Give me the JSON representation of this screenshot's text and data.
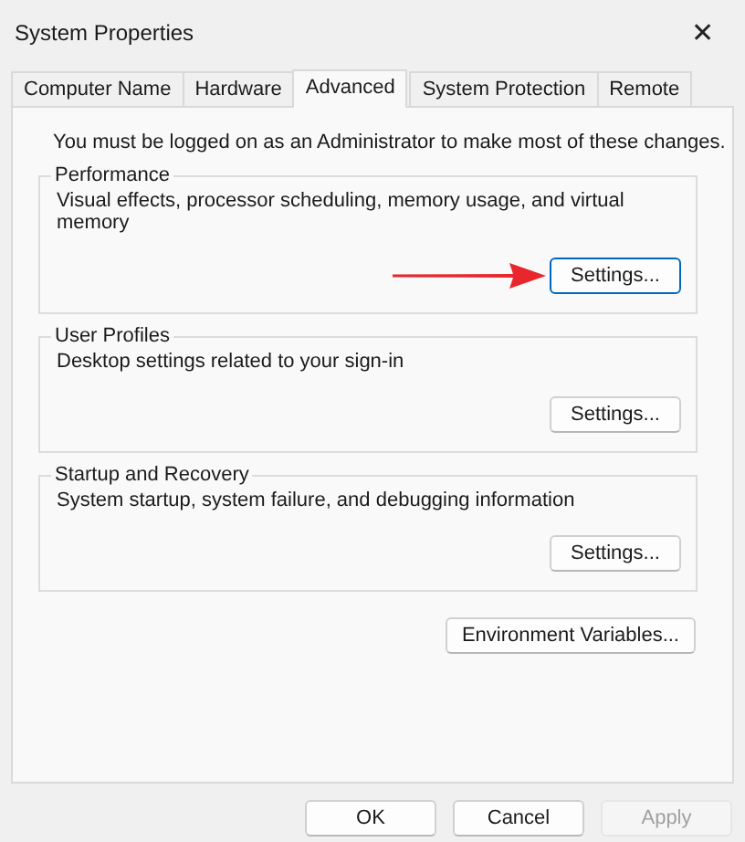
{
  "window": {
    "title": "System Properties",
    "close": "✕"
  },
  "tabs": [
    {
      "label": "Computer Name",
      "selected": false
    },
    {
      "label": "Hardware",
      "selected": false
    },
    {
      "label": "Advanced",
      "selected": true
    },
    {
      "label": "System Protection",
      "selected": false
    },
    {
      "label": "Remote",
      "selected": false
    }
  ],
  "notice": "You must be logged on as an Administrator to make most of these changes.",
  "groups": [
    {
      "title": "Performance",
      "description": "Visual effects, processor scheduling, memory usage, and virtual memory",
      "button": {
        "label": "Settings...",
        "focused": true,
        "pointed_at": true
      }
    },
    {
      "title": "User Profiles",
      "description": "Desktop settings related to your sign-in",
      "button": {
        "label": "Settings...",
        "focused": false
      }
    },
    {
      "title": "Startup and Recovery",
      "description": "System startup, system failure, and debugging information",
      "button": {
        "label": "Settings...",
        "focused": false
      }
    }
  ],
  "environment_button": {
    "label": "Environment Variables..."
  },
  "dialog_buttons": [
    {
      "label": "OK",
      "disabled": false
    },
    {
      "label": "Cancel",
      "disabled": false
    },
    {
      "label": "Apply",
      "disabled": true
    }
  ]
}
